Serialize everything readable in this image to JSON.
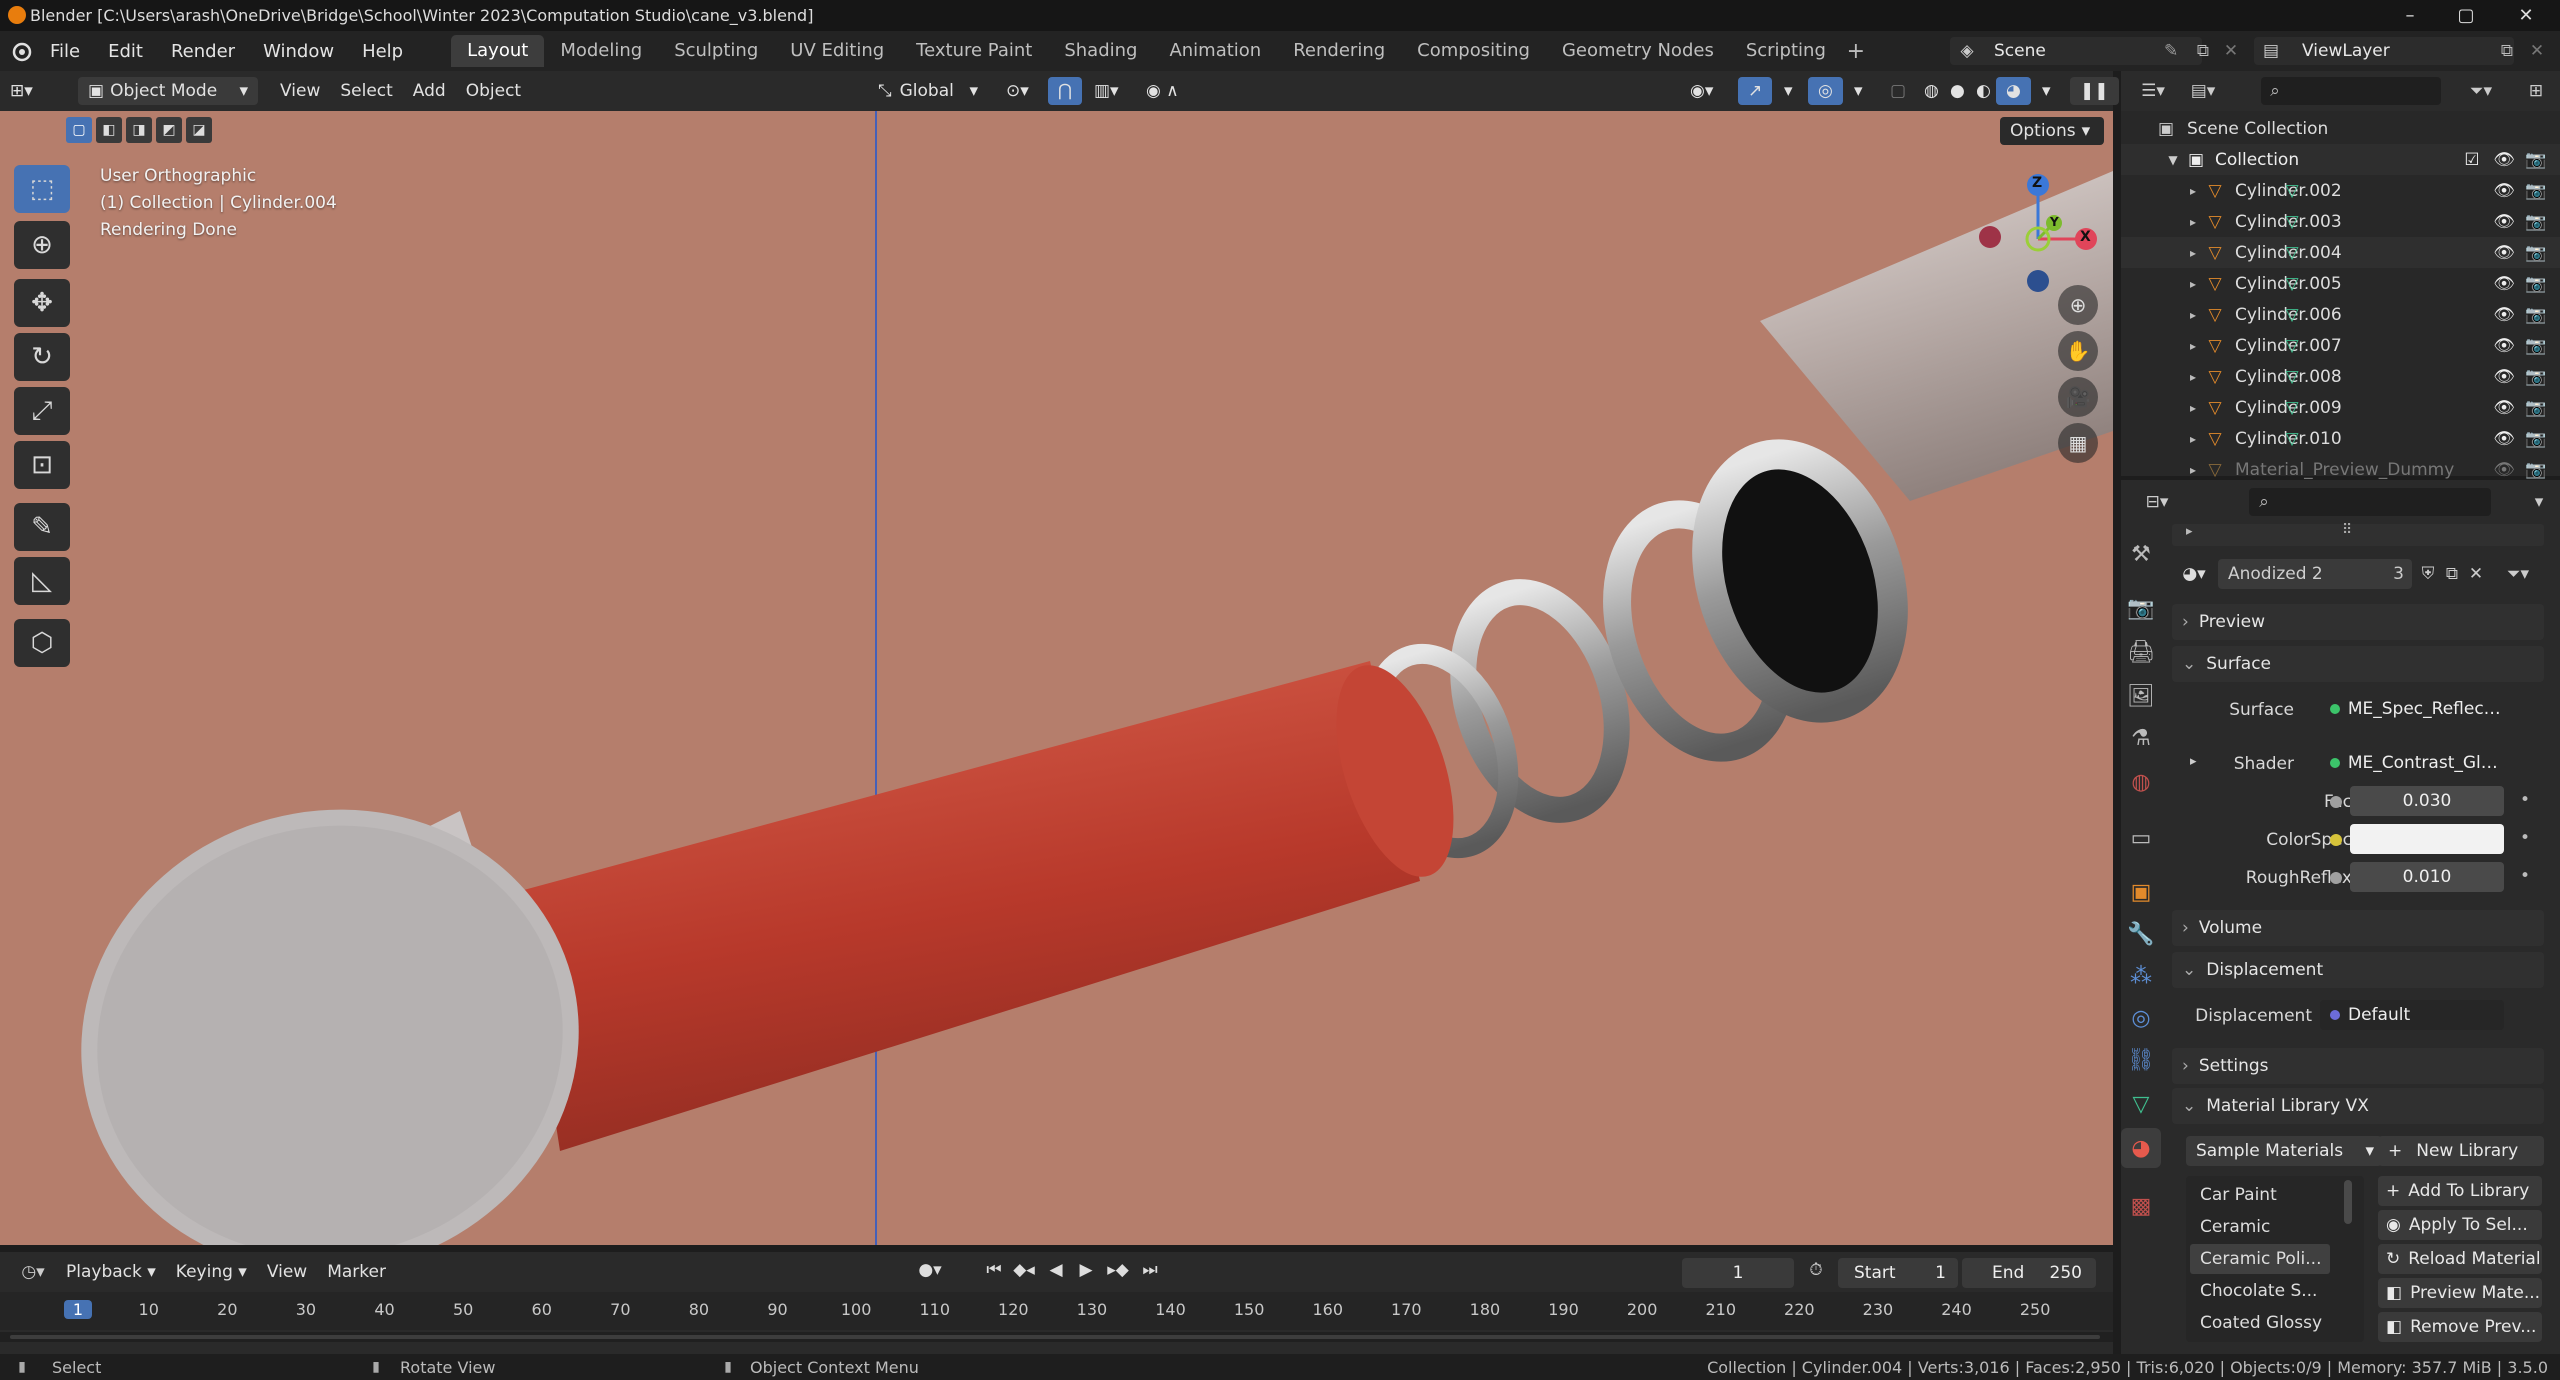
{
  "window": {
    "title": "Blender [C:\\Users\\arash\\OneDrive\\Bridge\\School\\Winter 2023\\Computation Studio\\cane_v3.blend]",
    "controls": [
      "–",
      "▢",
      "✕"
    ]
  },
  "menu": [
    "File",
    "Edit",
    "Render",
    "Window",
    "Help"
  ],
  "workspaces": [
    "Layout",
    "Modeling",
    "Sculpting",
    "UV Editing",
    "Texture Paint",
    "Shading",
    "Animation",
    "Rendering",
    "Compositing",
    "Geometry Nodes",
    "Scripting"
  ],
  "active_workspace": "Layout",
  "scene": {
    "name": "Scene"
  },
  "viewlayer": {
    "name": "ViewLayer"
  },
  "viewport_header": {
    "mode": "Object Mode",
    "menus": [
      "View",
      "Select",
      "Add",
      "Object"
    ],
    "orientation": "Global",
    "options": "Options"
  },
  "viewport": {
    "view_name": "User Orthographic",
    "collection_info": "(1) Collection | Cylinder.004",
    "status": "Rendering Done",
    "gizmo": {
      "z": "Z",
      "y": "Y",
      "x": "X"
    }
  },
  "outliner": {
    "root": "Scene Collection",
    "collection": "Collection",
    "items": [
      "Cylinder.002",
      "Cylinder.003",
      "Cylinder.004",
      "Cylinder.005",
      "Cylinder.006",
      "Cylinder.007",
      "Cylinder.008",
      "Cylinder.009",
      "Cylinder.010",
      "Material_Preview_Dummy"
    ]
  },
  "material": {
    "name": "Anodized 2",
    "users": "3",
    "sections": {
      "preview": "Preview",
      "surface": "Surface",
      "volume": "Volume",
      "displacement": "Displacement",
      "settings": "Settings",
      "library": "Material Library VX"
    },
    "surface_label": "Surface",
    "surface_value": "ME_Spec_Reflect...",
    "shader_label": "Shader",
    "shader_value": "ME_Contrast_Glo...",
    "fac_label": "Fac",
    "fac_value": "0.030",
    "colorspec_label": "ColorSpec",
    "roughreflex_label": "RoughReflex",
    "roughreflex_value": "0.010",
    "displacement_label": "Displacement",
    "displacement_value": "Default"
  },
  "library": {
    "selected": "Sample Materials",
    "new_library": "New Library",
    "items": [
      "Car Paint",
      "Ceramic",
      "Ceramic Poli...",
      "Chocolate S...",
      "Coated Glossy"
    ],
    "selected_item": "Ceramic Poli...",
    "buttons": [
      "Add To Library",
      "Apply To Sel...",
      "Reload Material",
      "Preview Mate...",
      "Remove Prev..."
    ]
  },
  "timeline": {
    "menus": [
      "Playback",
      "Keying",
      "View",
      "Marker"
    ],
    "current_frame": "1",
    "start_label": "Start",
    "start": "1",
    "end_label": "End",
    "end": "250",
    "ticks": [
      "1",
      "10",
      "20",
      "30",
      "40",
      "50",
      "60",
      "70",
      "80",
      "90",
      "100",
      "110",
      "120",
      "130",
      "140",
      "150",
      "160",
      "170",
      "180",
      "190",
      "200",
      "210",
      "220",
      "230",
      "240",
      "250"
    ]
  },
  "statusbar": {
    "select": "Select",
    "rotate": "Rotate View",
    "context": "Object Context Menu",
    "stats": "Collection | Cylinder.004 | Verts:3,016 | Faces:2,950 | Tris:6,020 | Objects:0/9 | Memory: 357.7 MiB | 3.5.0"
  },
  "colors": {
    "accent_blue": "#4672b3",
    "viewport_bg": "#b57e6c",
    "cane_red": "#b3392c",
    "cane_cap": "#c8c4c4"
  }
}
